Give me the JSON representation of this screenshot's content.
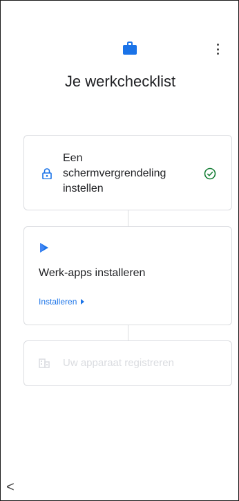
{
  "header": {
    "title": "Je werkchecklist",
    "brand_color": "#1a73e8",
    "icons": [
      "briefcase-icon",
      "more-vert-icon"
    ]
  },
  "checklist": {
    "step1": {
      "label": "Een schermvergrendeling instellen",
      "label_lines": [
        "Een",
        "schermvergrendeling",
        "instellen"
      ],
      "status": "completed",
      "icon": "lock-icon",
      "status_icon": "check-circle-icon",
      "status_color": "#188038"
    },
    "step2": {
      "label": "Werk-apps installeren",
      "action_label": "Installeren",
      "icon": "play-store-icon"
    },
    "step3": {
      "label": "Uw apparaat registreren",
      "state": "disabled",
      "icon": "building-icon"
    }
  },
  "nav": {
    "back_icon": "back-chevron-icon",
    "back_glyph": "<"
  }
}
